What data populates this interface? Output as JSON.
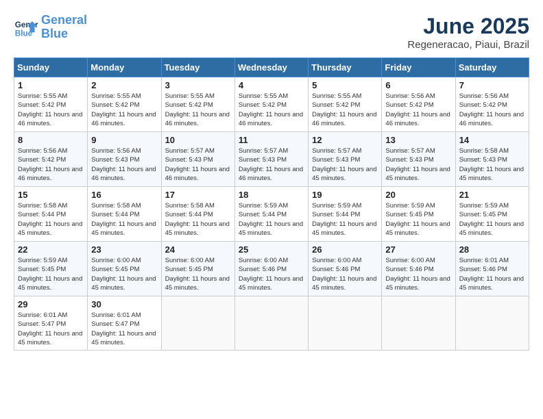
{
  "header": {
    "logo_line1": "General",
    "logo_line2": "Blue",
    "month_title": "June 2025",
    "subtitle": "Regeneracao, Piaui, Brazil"
  },
  "days_of_week": [
    "Sunday",
    "Monday",
    "Tuesday",
    "Wednesday",
    "Thursday",
    "Friday",
    "Saturday"
  ],
  "weeks": [
    [
      {
        "day": "1",
        "sunrise": "5:55 AM",
        "sunset": "5:42 PM",
        "daylight": "11 hours and 46 minutes."
      },
      {
        "day": "2",
        "sunrise": "5:55 AM",
        "sunset": "5:42 PM",
        "daylight": "11 hours and 46 minutes."
      },
      {
        "day": "3",
        "sunrise": "5:55 AM",
        "sunset": "5:42 PM",
        "daylight": "11 hours and 46 minutes."
      },
      {
        "day": "4",
        "sunrise": "5:55 AM",
        "sunset": "5:42 PM",
        "daylight": "11 hours and 46 minutes."
      },
      {
        "day": "5",
        "sunrise": "5:55 AM",
        "sunset": "5:42 PM",
        "daylight": "11 hours and 46 minutes."
      },
      {
        "day": "6",
        "sunrise": "5:56 AM",
        "sunset": "5:42 PM",
        "daylight": "11 hours and 46 minutes."
      },
      {
        "day": "7",
        "sunrise": "5:56 AM",
        "sunset": "5:42 PM",
        "daylight": "11 hours and 46 minutes."
      }
    ],
    [
      {
        "day": "8",
        "sunrise": "5:56 AM",
        "sunset": "5:42 PM",
        "daylight": "11 hours and 46 minutes."
      },
      {
        "day": "9",
        "sunrise": "5:56 AM",
        "sunset": "5:43 PM",
        "daylight": "11 hours and 46 minutes."
      },
      {
        "day": "10",
        "sunrise": "5:57 AM",
        "sunset": "5:43 PM",
        "daylight": "11 hours and 46 minutes."
      },
      {
        "day": "11",
        "sunrise": "5:57 AM",
        "sunset": "5:43 PM",
        "daylight": "11 hours and 46 minutes."
      },
      {
        "day": "12",
        "sunrise": "5:57 AM",
        "sunset": "5:43 PM",
        "daylight": "11 hours and 45 minutes."
      },
      {
        "day": "13",
        "sunrise": "5:57 AM",
        "sunset": "5:43 PM",
        "daylight": "11 hours and 45 minutes."
      },
      {
        "day": "14",
        "sunrise": "5:58 AM",
        "sunset": "5:43 PM",
        "daylight": "11 hours and 45 minutes."
      }
    ],
    [
      {
        "day": "15",
        "sunrise": "5:58 AM",
        "sunset": "5:44 PM",
        "daylight": "11 hours and 45 minutes."
      },
      {
        "day": "16",
        "sunrise": "5:58 AM",
        "sunset": "5:44 PM",
        "daylight": "11 hours and 45 minutes."
      },
      {
        "day": "17",
        "sunrise": "5:58 AM",
        "sunset": "5:44 PM",
        "daylight": "11 hours and 45 minutes."
      },
      {
        "day": "18",
        "sunrise": "5:59 AM",
        "sunset": "5:44 PM",
        "daylight": "11 hours and 45 minutes."
      },
      {
        "day": "19",
        "sunrise": "5:59 AM",
        "sunset": "5:44 PM",
        "daylight": "11 hours and 45 minutes."
      },
      {
        "day": "20",
        "sunrise": "5:59 AM",
        "sunset": "5:45 PM",
        "daylight": "11 hours and 45 minutes."
      },
      {
        "day": "21",
        "sunrise": "5:59 AM",
        "sunset": "5:45 PM",
        "daylight": "11 hours and 45 minutes."
      }
    ],
    [
      {
        "day": "22",
        "sunrise": "5:59 AM",
        "sunset": "5:45 PM",
        "daylight": "11 hours and 45 minutes."
      },
      {
        "day": "23",
        "sunrise": "6:00 AM",
        "sunset": "5:45 PM",
        "daylight": "11 hours and 45 minutes."
      },
      {
        "day": "24",
        "sunrise": "6:00 AM",
        "sunset": "5:45 PM",
        "daylight": "11 hours and 45 minutes."
      },
      {
        "day": "25",
        "sunrise": "6:00 AM",
        "sunset": "5:46 PM",
        "daylight": "11 hours and 45 minutes."
      },
      {
        "day": "26",
        "sunrise": "6:00 AM",
        "sunset": "5:46 PM",
        "daylight": "11 hours and 45 minutes."
      },
      {
        "day": "27",
        "sunrise": "6:00 AM",
        "sunset": "5:46 PM",
        "daylight": "11 hours and 45 minutes."
      },
      {
        "day": "28",
        "sunrise": "6:01 AM",
        "sunset": "5:46 PM",
        "daylight": "11 hours and 45 minutes."
      }
    ],
    [
      {
        "day": "29",
        "sunrise": "6:01 AM",
        "sunset": "5:47 PM",
        "daylight": "11 hours and 45 minutes."
      },
      {
        "day": "30",
        "sunrise": "6:01 AM",
        "sunset": "5:47 PM",
        "daylight": "11 hours and 45 minutes."
      },
      null,
      null,
      null,
      null,
      null
    ]
  ]
}
